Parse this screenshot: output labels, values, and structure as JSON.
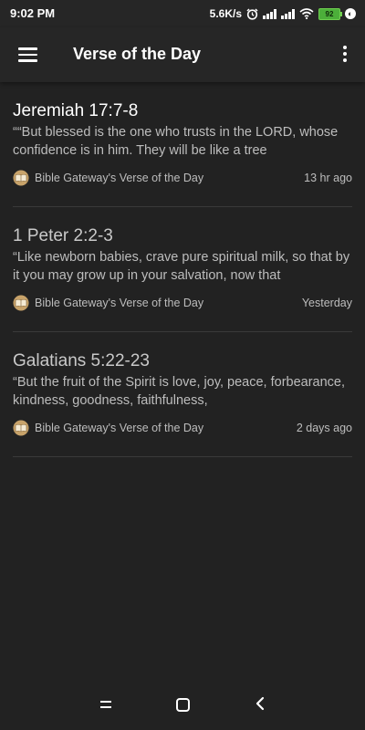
{
  "status_bar": {
    "time": "9:02 PM",
    "net_speed": "5.6K/s",
    "battery": "92"
  },
  "app_bar": {
    "title": "Verse of the Day",
    "menu_icon": "hamburger-menu-icon",
    "more_icon": "more-vert-icon"
  },
  "verses": [
    {
      "reference": "Jeremiah 17:7-8",
      "excerpt": "““But blessed is the one who trusts in the LORD, whose confidence is in him. They will be like a tree",
      "source": "Bible Gateway's Verse of the Day",
      "time": "13 hr ago"
    },
    {
      "reference": "1 Peter 2:2-3",
      "excerpt": "“Like newborn babies, crave pure spiritual milk, so that by it you may grow up in your salvation, now that",
      "source": "Bible Gateway's Verse of the Day",
      "time": "Yesterday"
    },
    {
      "reference": "Galatians 5:22-23",
      "excerpt": "“But the fruit of the Spirit is love, joy, peace, forbearance, kindness, goodness, faithfulness,",
      "source": "Bible Gateway's Verse of the Day",
      "time": "2 days ago"
    }
  ],
  "colors": {
    "background": "#222222",
    "app_bar": "#262626",
    "divider": "#3a3a3a",
    "secondary_text": "#bdbdbd",
    "battery": "#4caf3a"
  }
}
